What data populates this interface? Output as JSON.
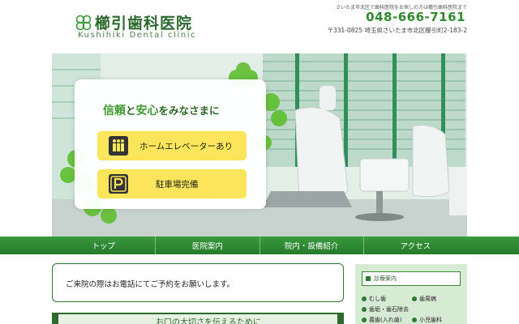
{
  "header": {
    "clinic_name": "櫛引歯科医院",
    "clinic_name_en": "Kushihiki Dental clinic",
    "tagline": "さいたま市北区で歯科医院をお探しの方は櫛引歯科医院まで",
    "phone": "048-666-7161",
    "address": "〒331-0825 埼玉県さいたま市北区櫛引町2-183-2"
  },
  "hero": {
    "heading_part1": "信頼",
    "heading_and": "と",
    "heading_part2": "安心",
    "heading_rest": "をみなさまに",
    "features": [
      {
        "label": "ホームエレベーターあり",
        "icon": "elevator-icon"
      },
      {
        "label": "駐車場完備",
        "icon": "parking-icon"
      }
    ]
  },
  "nav": {
    "items": [
      {
        "label": "トップ"
      },
      {
        "label": "医院案内"
      },
      {
        "label": "院内・設備紹介"
      },
      {
        "label": "アクセス"
      }
    ]
  },
  "notice": {
    "text": "ご来院の際はお電話にてご予約をお願いします。"
  },
  "section": {
    "heading_partial": "お口の大切さを伝えるために"
  },
  "sidebar": {
    "title": "診療案内",
    "items": [
      {
        "label": "むし歯"
      },
      {
        "label": "歯周病"
      },
      {
        "label": "歯垢・歯石除去"
      },
      {
        "label": "義歯(入れ歯)"
      },
      {
        "label": "小児歯科"
      }
    ]
  },
  "colors": {
    "brand_green": "#2d7a32",
    "nav_green": "#2f8a33",
    "feature_yellow": "#fbe55a",
    "phone_green": "#2f8a2f"
  }
}
